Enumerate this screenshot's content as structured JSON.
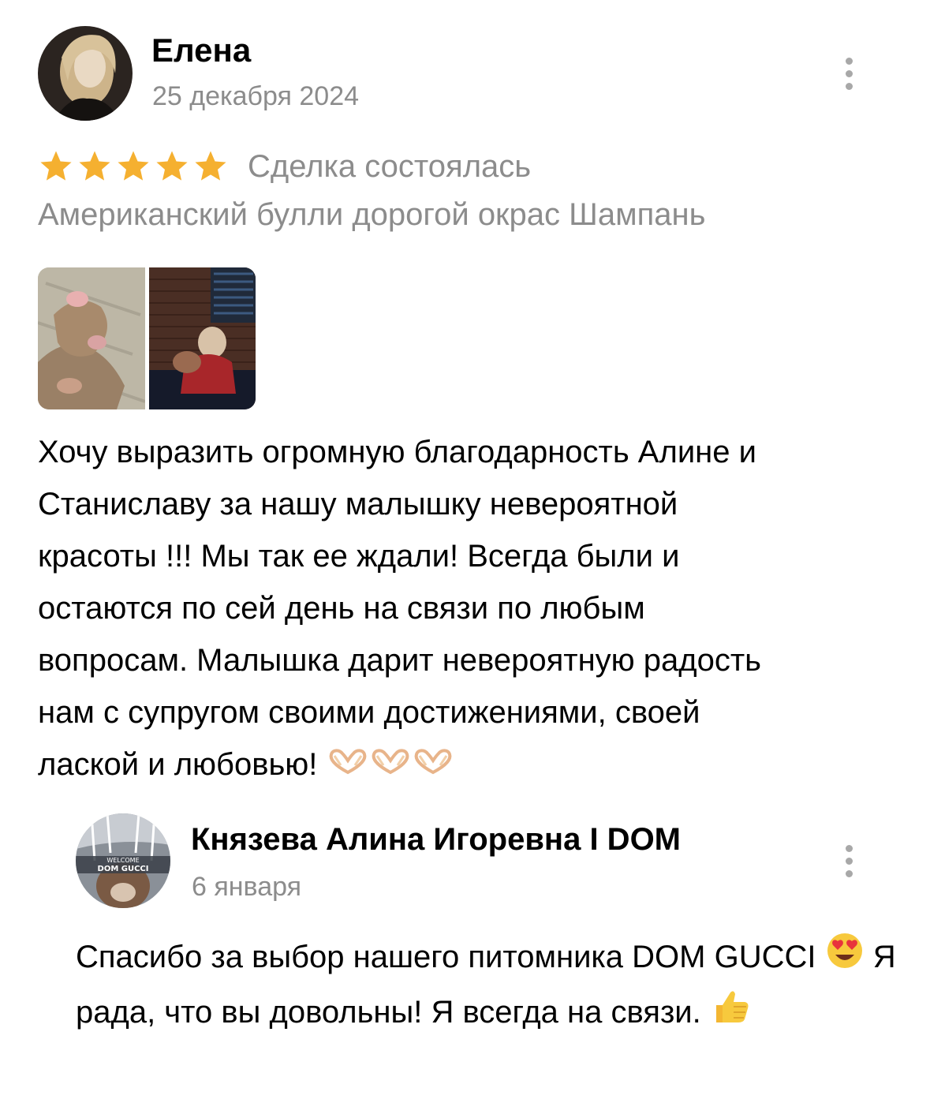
{
  "review": {
    "author": "Елена",
    "date": "25 декабря 2024",
    "rating": 5,
    "rating_max": 5,
    "deal_status": "Сделка состоялась",
    "item_title": "Американский булли дорогой окрас Шампань",
    "photos": [
      {
        "icon": "photo-paws-thumbnail"
      },
      {
        "icon": "photo-woman-with-puppy-thumbnail"
      }
    ],
    "text": "Хочу выразить огромную благодарность Алине и\nСтаниславу за нашу  малышку невероятной\nкрасоты !!! Мы так ее ждали! Всегда были и\nостаются по сей день  на связи по любым\nвопросам. Малышка дарит невероятную радость\nнам с супругом своими достижениями, своей\nлаской и любовью!",
    "text_emojis": [
      "heart-hands-emoji",
      "heart-hands-emoji",
      "heart-hands-emoji"
    ],
    "menu_icon": "more-vertical-icon"
  },
  "reply": {
    "author": "Князева Алина Игоревна I DOM",
    "date": "6 января",
    "avatar_text_top": "WELCOME",
    "avatar_text_bottom": "DOM GUCCI",
    "text_part1": "Спасибо за выбор нашего питомника DOM GUCCI",
    "text_part2": "Я рада, что вы довольны! Я всегда на связи.",
    "text_emojis": [
      "heart-eyes-emoji",
      "thumbs-up-emoji"
    ],
    "menu_icon": "more-vertical-icon"
  },
  "colors": {
    "star": "#f5b030",
    "secondary_text": "#8c8c8c",
    "primary_text": "#000000"
  }
}
